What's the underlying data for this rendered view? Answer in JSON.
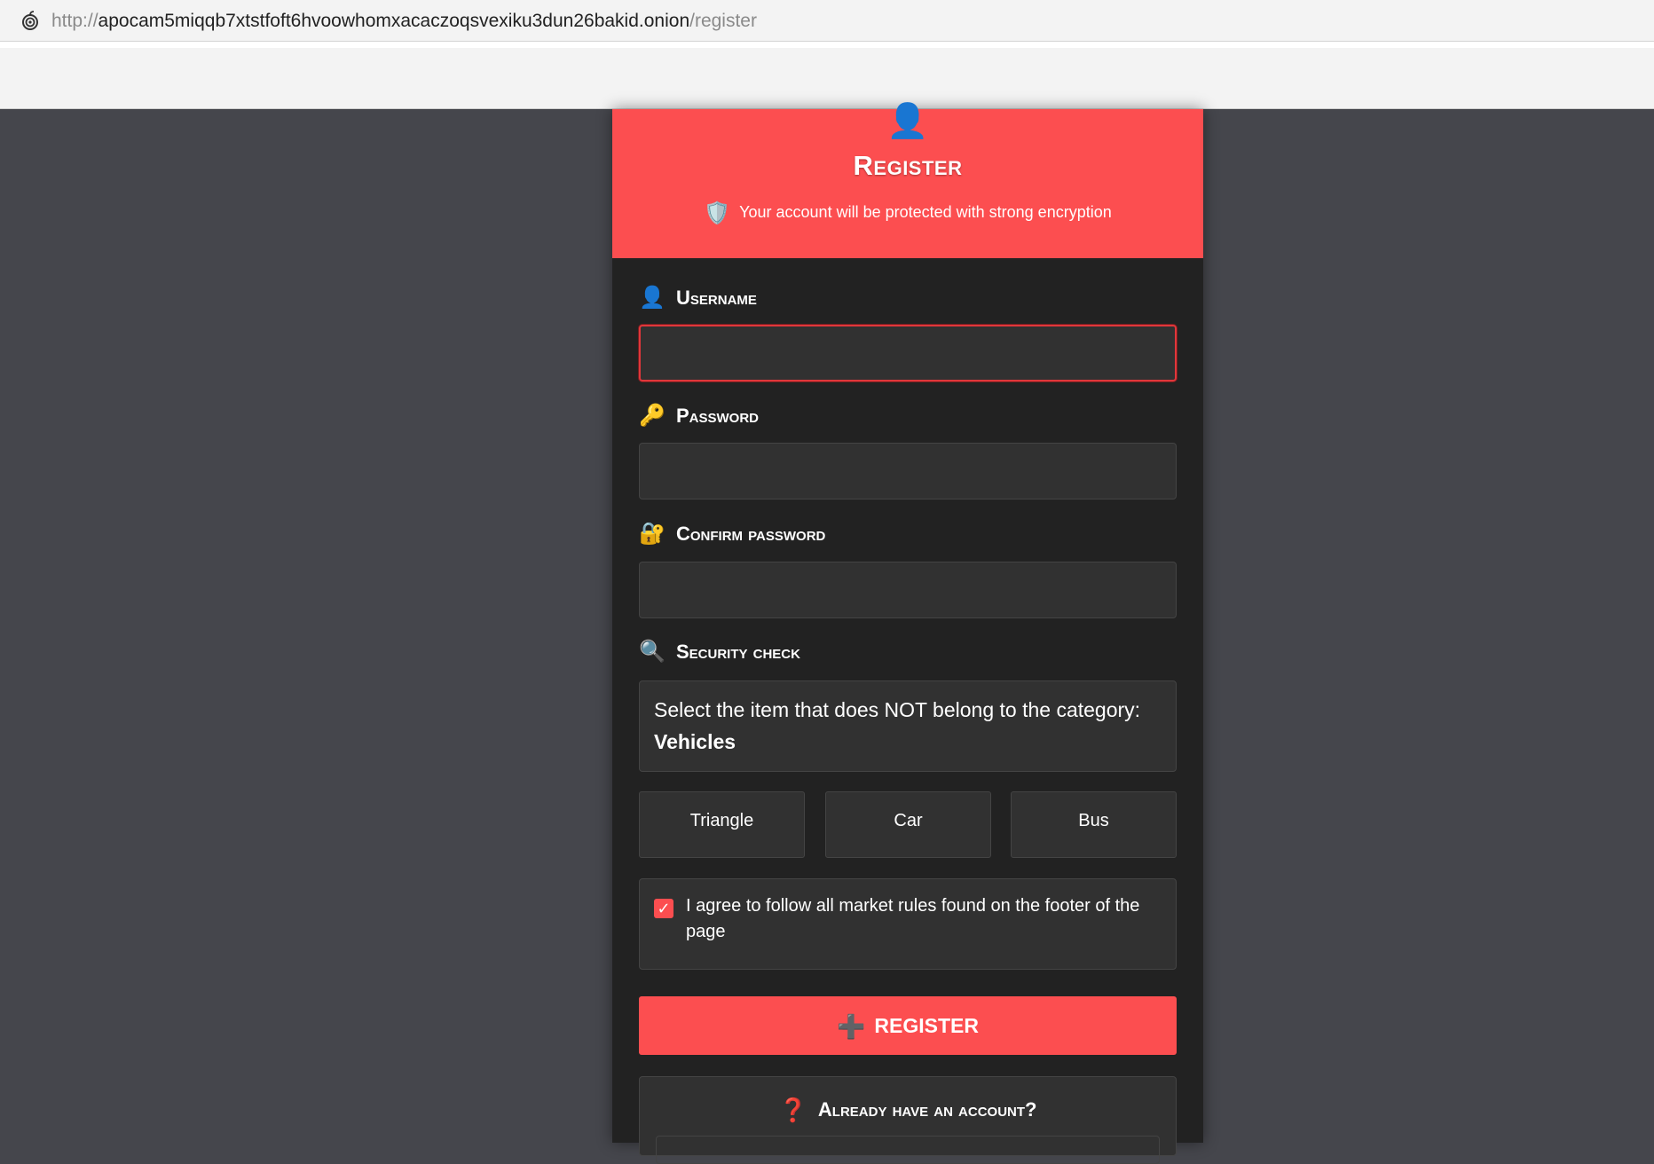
{
  "browser": {
    "url_scheme": "http://",
    "url_host": "apocam5miqqb7xtstfoft6hvoowhomxacaczoqsvexiku3dun26bakid.onion",
    "url_path": "/register",
    "lock_icon": "onion-icon"
  },
  "header": {
    "icon": "👤",
    "title": "Register",
    "subtitle_icon": "🛡️",
    "subtitle": "Your account will be protected with strong encryption"
  },
  "form": {
    "username_icon": "👤",
    "username_label": "Username",
    "username_value": "",
    "password_icon": "🔑",
    "password_label": "Password",
    "password_value": "",
    "confirm_icon": "🔐",
    "confirm_label": "Confirm password",
    "confirm_value": "",
    "security_icon": "🔍",
    "security_label": "Security check",
    "captcha_prompt": "Select the item that does NOT belong to the category:",
    "captcha_category": "Vehicles",
    "captcha_options": [
      "Triangle",
      "Car",
      "Bus"
    ],
    "agree_checked": true,
    "agree_text": "I agree to follow all market rules found on the footer of the page",
    "submit_icon": "➕",
    "submit_label": "REGISTER",
    "already_icon": "❓",
    "already_label": "Already have an account?"
  },
  "colors": {
    "accent": "#fc4e50",
    "card_bg": "#222222",
    "page_bg": "#45464c"
  }
}
